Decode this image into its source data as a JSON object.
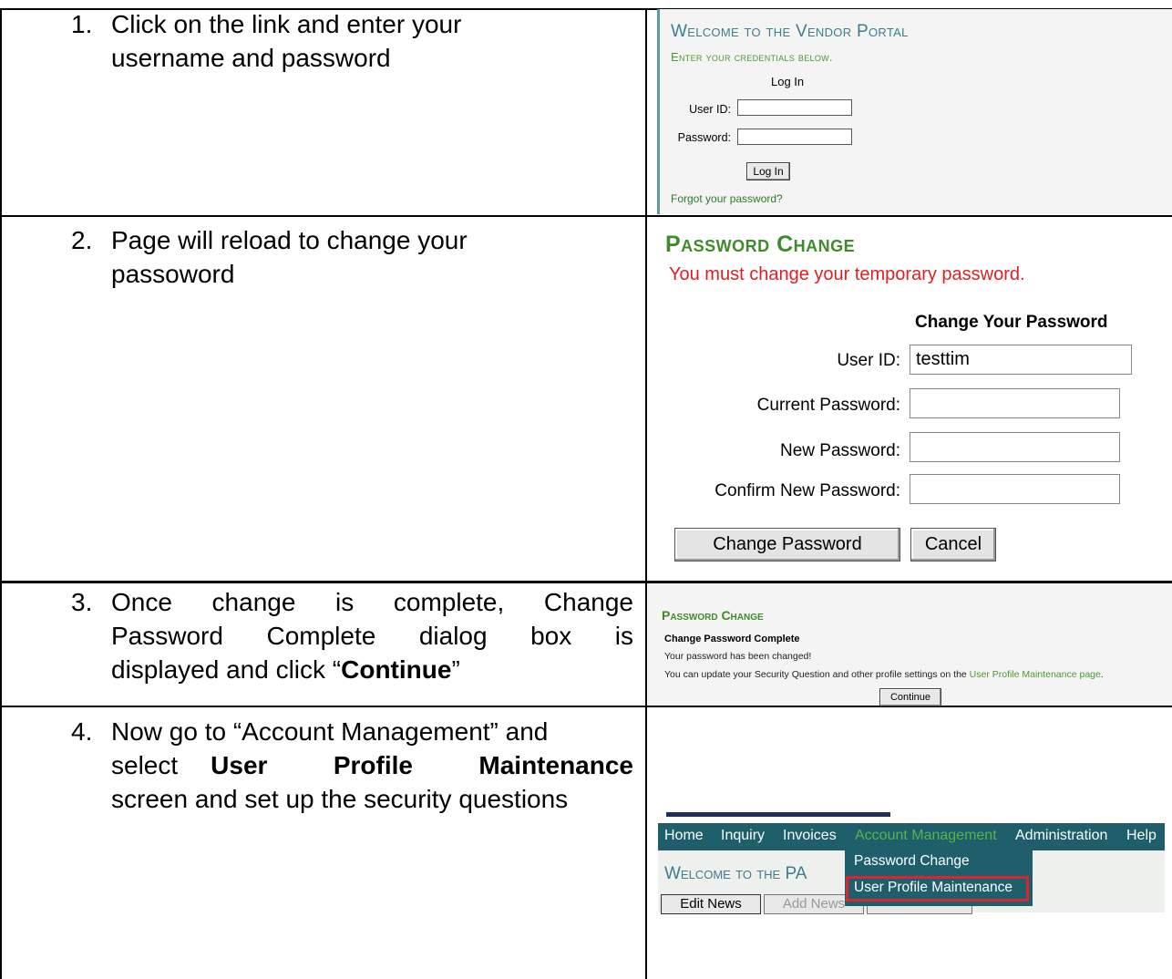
{
  "steps": [
    {
      "number": "1.",
      "line1": "Click on the link and enter your",
      "line2": "username and password"
    },
    {
      "number": "2.",
      "line1": "Page will reload to change your",
      "line2": "passoword"
    },
    {
      "number": "3.",
      "line1": "Once change is complete, Change",
      "line2": "Password Complete dialog box is",
      "line3_pre": "displayed and click “",
      "line3_bold": "Continue",
      "line3_post": "”"
    },
    {
      "number": "4.",
      "line1": "Now go to “Account Management” and",
      "line2_pre": "select",
      "line2_bold": "User Profile Maintenance",
      "line3": "screen and set up the security questions"
    }
  ],
  "vendor_login": {
    "title": "Welcome to the Vendor Portal",
    "subtitle": "Enter your credentials below.",
    "login_heading": "Log In",
    "user_id_label": "User ID:",
    "password_label": "Password:",
    "button": "Log In",
    "forgot_link": "Forgot your password?"
  },
  "password_change": {
    "heading": "Password Change",
    "warning": "You must change your temporary password.",
    "subheading": "Change Your Password",
    "user_id_label": "User ID:",
    "user_id_value": "testtim",
    "current_label": "Current Password:",
    "new_label": "New Password:",
    "confirm_label": "Confirm New Password:",
    "change_button": "Change Password",
    "cancel_button": "Cancel"
  },
  "complete": {
    "heading": "Password Change",
    "subheading": "Change Password Complete",
    "line1": "Your password has been changed!",
    "line2_pre": "You can update your Security Question and other profile settings on the ",
    "line2_link": "User Profile Maintenance page",
    "line2_post": ".",
    "button": "Continue"
  },
  "menu": {
    "nav": [
      "Home",
      "Inquiry",
      "Invoices",
      "Account Management",
      "Administration",
      "Help"
    ],
    "page_title": "Welcome to the PA",
    "dropdown": [
      "Password Change",
      "User Profile Maintenance"
    ],
    "buttons": [
      "Edit News",
      "Add News"
    ],
    "colors": {
      "nav_bg": "#1e5f6b",
      "active": "#56b44a",
      "highlight_border": "#d8252f"
    }
  }
}
